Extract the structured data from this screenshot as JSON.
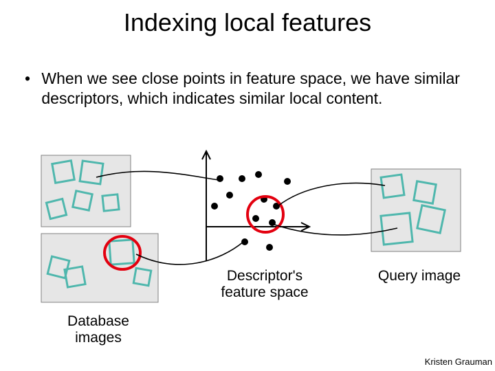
{
  "title": "Indexing local features",
  "bullet": "When we see close points in feature space, we have similar descriptors, which indicates similar local content.",
  "labels": {
    "descriptor": "Descriptor's feature space",
    "database": "Database images",
    "query": "Query image"
  },
  "credit": "Kristen Grauman"
}
